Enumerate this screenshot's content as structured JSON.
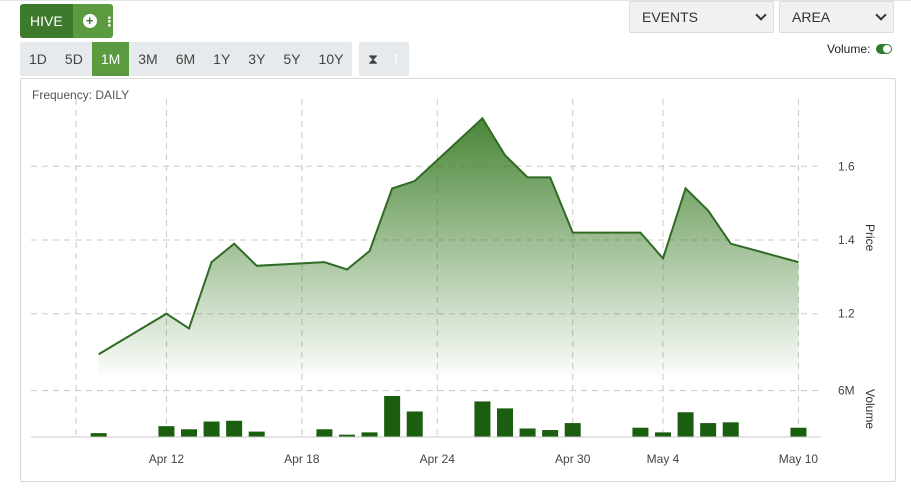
{
  "symbol": {
    "ticker": "HIVE",
    "add_icon": "plus-circle-icon",
    "menu_icon": "vertical-dots-icon"
  },
  "ranges": [
    "1D",
    "5D",
    "1M",
    "3M",
    "6M",
    "1Y",
    "3Y",
    "5Y",
    "10Y"
  ],
  "active_range": "1M",
  "tools": {
    "compare_icon": "hourglass-icon",
    "more_icon": "vertical-dots-icon"
  },
  "events_dropdown": {
    "label": "EVENTS"
  },
  "chart_type_dropdown": {
    "label": "AREA"
  },
  "volume_toggle": {
    "label": "Volume:",
    "on": true
  },
  "frequency_label": "Frequency: DAILY",
  "colors": {
    "accent": "#3e7a2b",
    "accent_light": "#5b9a3e",
    "line": "#2f6b23",
    "volume_bar": "#1b5e10"
  },
  "chart_data": [
    {
      "type": "area",
      "x": [
        "2021-04-09",
        "2021-04-12",
        "2021-04-13",
        "2021-04-14",
        "2021-04-15",
        "2021-04-16",
        "2021-04-19",
        "2021-04-20",
        "2021-04-21",
        "2021-04-22",
        "2021-04-23",
        "2021-04-26",
        "2021-04-27",
        "2021-04-28",
        "2021-04-29",
        "2021-04-30",
        "2021-05-03",
        "2021-05-04",
        "2021-05-05",
        "2021-05-06",
        "2021-05-07",
        "2021-05-10"
      ],
      "series": [
        {
          "values": [
            1.09,
            1.2,
            1.16,
            1.34,
            1.39,
            1.33,
            1.34,
            1.32,
            1.37,
            1.54,
            1.56,
            1.73,
            1.63,
            1.57,
            1.57,
            1.42,
            1.42,
            1.35,
            1.54,
            1.48,
            1.39,
            1.34
          ]
        }
      ],
      "xticks": [
        "Apr 12",
        "Apr 18",
        "Apr 24",
        "Apr 30",
        "May 4",
        "May 10"
      ],
      "yticks": [
        1.2,
        1.4,
        1.6
      ],
      "ylabel": "Price",
      "ylim": [
        1.05,
        1.75
      ],
      "grid": true
    },
    {
      "type": "bar",
      "x": [
        "2021-04-09",
        "2021-04-12",
        "2021-04-13",
        "2021-04-14",
        "2021-04-15",
        "2021-04-16",
        "2021-04-19",
        "2021-04-20",
        "2021-04-21",
        "2021-04-22",
        "2021-04-23",
        "2021-04-26",
        "2021-04-27",
        "2021-04-28",
        "2021-04-29",
        "2021-04-30",
        "2021-05-03",
        "2021-05-04",
        "2021-05-05",
        "2021-05-06",
        "2021-05-07",
        "2021-05-10"
      ],
      "series": [
        {
          "values": [
            0.5,
            1.4,
            1.0,
            2.0,
            2.1,
            0.7,
            1.0,
            0.3,
            0.6,
            5.3,
            3.3,
            4.6,
            3.7,
            1.1,
            0.9,
            1.8,
            1.2,
            0.6,
            3.2,
            1.8,
            1.9,
            1.2
          ]
        }
      ],
      "yticks": [
        6
      ],
      "ytick_labels": [
        "6M"
      ],
      "ylabel": "Volume",
      "ylim": [
        0,
        7.5
      ],
      "unit": "M"
    }
  ]
}
